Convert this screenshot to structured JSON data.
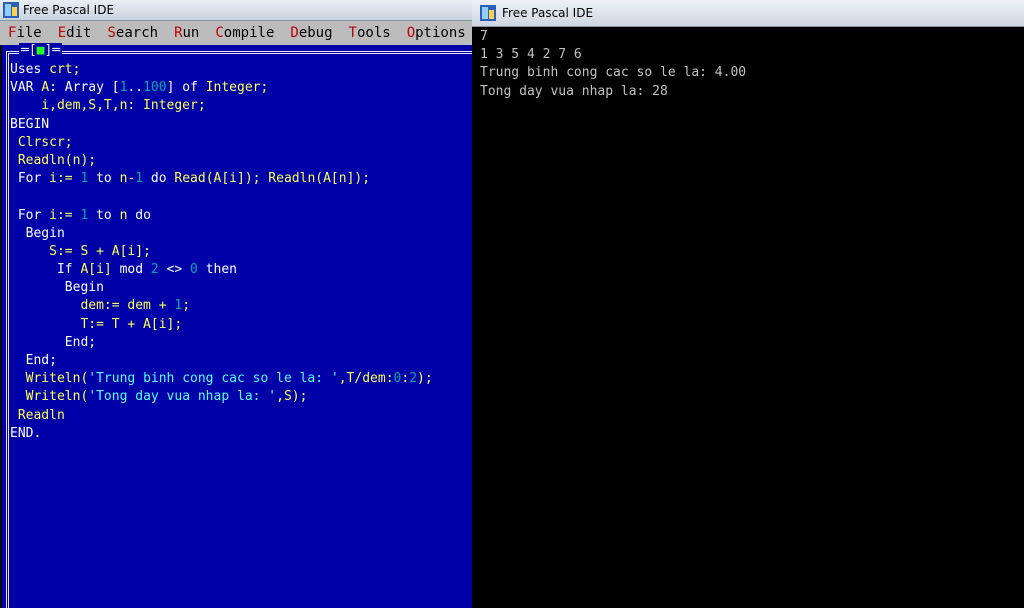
{
  "ide": {
    "title": "Free Pascal IDE",
    "menu": [
      {
        "hot": "F",
        "rest": "ile"
      },
      {
        "hot": "E",
        "rest": "dit"
      },
      {
        "hot": "S",
        "rest": "earch"
      },
      {
        "hot": "R",
        "rest": "un"
      },
      {
        "hot": "C",
        "rest": "ompile"
      },
      {
        "hot": "D",
        "rest": "ebug"
      },
      {
        "hot": "T",
        "rest": "ools"
      },
      {
        "hot": "O",
        "rest": "ptions"
      }
    ],
    "close_box_left": "[",
    "close_box_mark": "■",
    "close_box_right": "]",
    "code_lines": [
      [
        {
          "t": "Uses ",
          "c": "kw"
        },
        {
          "t": "crt;",
          "c": "id"
        }
      ],
      [
        {
          "t": "VAR ",
          "c": "kw"
        },
        {
          "t": "A: ",
          "c": "id"
        },
        {
          "t": "Array ",
          "c": "kw"
        },
        {
          "t": "[",
          "c": "op"
        },
        {
          "t": "1",
          "c": "num"
        },
        {
          "t": "..",
          "c": "op"
        },
        {
          "t": "100",
          "c": "num"
        },
        {
          "t": "] ",
          "c": "op"
        },
        {
          "t": "of ",
          "c": "kw"
        },
        {
          "t": "Integer;",
          "c": "id"
        }
      ],
      [
        {
          "t": "    i,dem,S,T,n: Integer;",
          "c": "id"
        }
      ],
      [
        {
          "t": "BEGIN",
          "c": "kw"
        }
      ],
      [
        {
          "t": " Clrscr;",
          "c": "id"
        }
      ],
      [
        {
          "t": " Readln(n);",
          "c": "id"
        }
      ],
      [
        {
          "t": " For ",
          "c": "kw"
        },
        {
          "t": "i:= ",
          "c": "id"
        },
        {
          "t": "1",
          "c": "num"
        },
        {
          "t": " to ",
          "c": "kw"
        },
        {
          "t": "n-",
          "c": "id"
        },
        {
          "t": "1",
          "c": "num"
        },
        {
          "t": " do ",
          "c": "kw"
        },
        {
          "t": "Read(A[i]); Readln(A[n]);",
          "c": "id"
        }
      ],
      [
        {
          "t": "",
          "c": "op"
        }
      ],
      [
        {
          "t": " For ",
          "c": "kw"
        },
        {
          "t": "i:= ",
          "c": "id"
        },
        {
          "t": "1",
          "c": "num"
        },
        {
          "t": " to ",
          "c": "kw"
        },
        {
          "t": "n ",
          "c": "id"
        },
        {
          "t": "do",
          "c": "kw"
        }
      ],
      [
        {
          "t": "  Begin",
          "c": "kw"
        }
      ],
      [
        {
          "t": "     S:= S + A[i];",
          "c": "id"
        }
      ],
      [
        {
          "t": "      If ",
          "c": "kw"
        },
        {
          "t": "A[i] ",
          "c": "id"
        },
        {
          "t": "mod ",
          "c": "kw"
        },
        {
          "t": "2",
          "c": "num"
        },
        {
          "t": " <> ",
          "c": "op"
        },
        {
          "t": "0",
          "c": "num"
        },
        {
          "t": " then",
          "c": "kw"
        }
      ],
      [
        {
          "t": "       Begin",
          "c": "kw"
        }
      ],
      [
        {
          "t": "         dem:= dem + ",
          "c": "id"
        },
        {
          "t": "1",
          "c": "num"
        },
        {
          "t": ";",
          "c": "id"
        }
      ],
      [
        {
          "t": "         T:= T + A[i];",
          "c": "id"
        }
      ],
      [
        {
          "t": "       End;",
          "c": "kw"
        }
      ],
      [
        {
          "t": "  End;",
          "c": "kw"
        }
      ],
      [
        {
          "t": "  Writeln(",
          "c": "id"
        },
        {
          "t": "'Trung binh cong cac so le la: '",
          "c": "str"
        },
        {
          "t": ",T/dem:",
          "c": "id"
        },
        {
          "t": "0",
          "c": "num"
        },
        {
          "t": ":",
          "c": "id"
        },
        {
          "t": "2",
          "c": "num"
        },
        {
          "t": ");",
          "c": "id"
        }
      ],
      [
        {
          "t": "  Writeln(",
          "c": "id"
        },
        {
          "t": "'Tong day vua nhap la: '",
          "c": "str"
        },
        {
          "t": ",S);",
          "c": "id"
        }
      ],
      [
        {
          "t": " Readln",
          "c": "id"
        }
      ],
      [
        {
          "t": "END.",
          "c": "kw"
        }
      ]
    ]
  },
  "console": {
    "title": "Free Pascal IDE",
    "lines": [
      "7",
      "1 3 5 4 2 7 6",
      "Trung binh cong cac so le la: 4.00",
      "Tong day vua nhap la: 28"
    ]
  },
  "colors": {
    "editor_bg": "#0000a8",
    "identifier": "#ffff55",
    "keyword": "#ffffff",
    "number": "#00aaaa",
    "string": "#55ffff",
    "menu_bg": "#bcbcbc",
    "hotkey": "#c00000"
  }
}
